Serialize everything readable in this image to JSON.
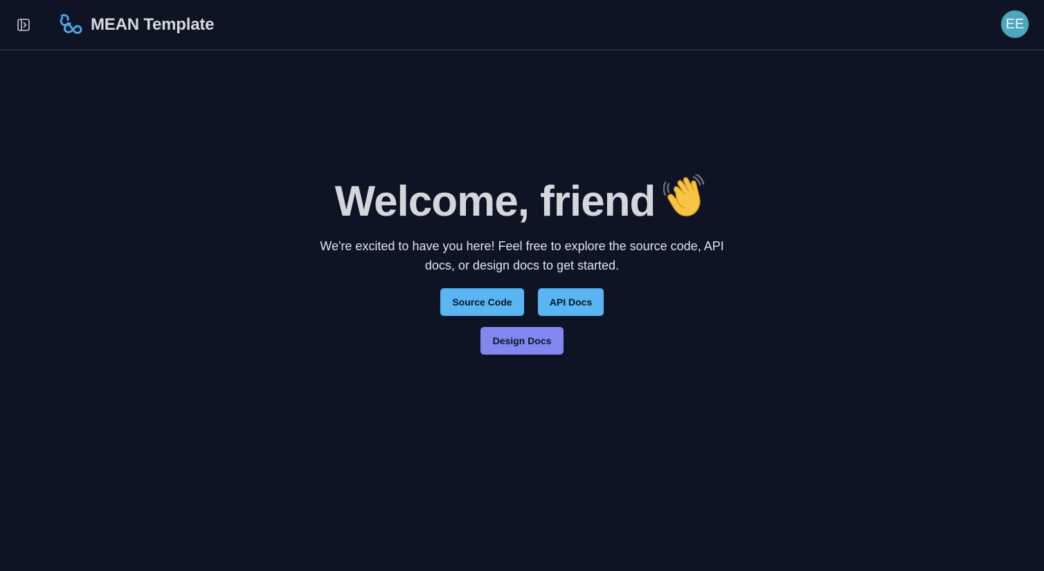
{
  "header": {
    "app_title": "MEAN Template",
    "sidebar_toggle_icon": "sidebar-toggle-icon",
    "logo_icon": "infinity-logo-icon",
    "avatar_initials": "EE",
    "avatar_color": "#4aa7bd"
  },
  "hero": {
    "heading": "Welcome, friend",
    "heading_icon": "waving-hand-icon",
    "subtitle": "We're excited to have you here! Feel free to explore the source code, API docs, or design docs to get started."
  },
  "actions": {
    "source_code_label": "Source Code",
    "api_docs_label": "API Docs",
    "design_docs_label": "Design Docs",
    "primary_color": "#5ab6f3",
    "secondary_color": "#8286ef"
  },
  "colors": {
    "background": "#0f1424",
    "border": "#262c3b"
  }
}
